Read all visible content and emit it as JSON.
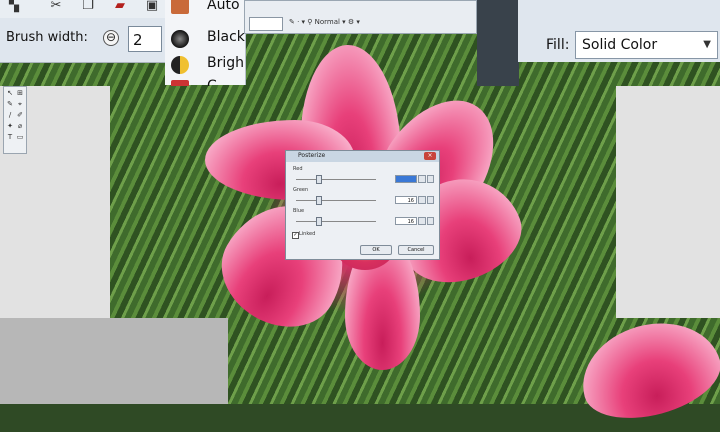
{
  "toolbar": {
    "icons": [
      "brush-icon",
      "scissors-icon",
      "copy-icon",
      "paste-icon",
      "crop-icon"
    ],
    "brush_width_label": "Brush width:",
    "brush_width_decrement": "⊖",
    "brush_width_value": "2"
  },
  "adjustments_menu": {
    "items": [
      {
        "label": "Auto",
        "icon": "auto-level-icon"
      },
      {
        "label": "Black",
        "icon": "black-white-icon"
      },
      {
        "label": "Brigh",
        "icon": "brightness-icon"
      },
      {
        "label": "C",
        "icon": "curves-icon"
      }
    ]
  },
  "top_window": {
    "text": "✎ · ▾ ⚲ Normal ▾ ⚙ ▾"
  },
  "fill": {
    "label": "Fill:",
    "value": "Solid Color"
  },
  "tools_window": {
    "tools": [
      "↖",
      "⊞",
      "✎",
      "⌖",
      "/",
      "✐",
      "✦",
      "⌀",
      "T",
      "▭"
    ]
  },
  "dialog": {
    "title": "Posterize",
    "close": "×",
    "sliders": [
      {
        "label": "Red",
        "value": "",
        "level": 0.3
      },
      {
        "label": "Green",
        "value": "16",
        "level": 0.3
      },
      {
        "label": "Blue",
        "value": "16",
        "level": 0.3
      }
    ],
    "linked_label": "Linked",
    "linked_checked": "✓",
    "ok_label": "OK",
    "cancel_label": "Cancel"
  },
  "colors": {
    "toolbar_bg": "#dfe6ee",
    "petal_pink": "#e8407a",
    "leaf_green": "#4f7f35"
  }
}
